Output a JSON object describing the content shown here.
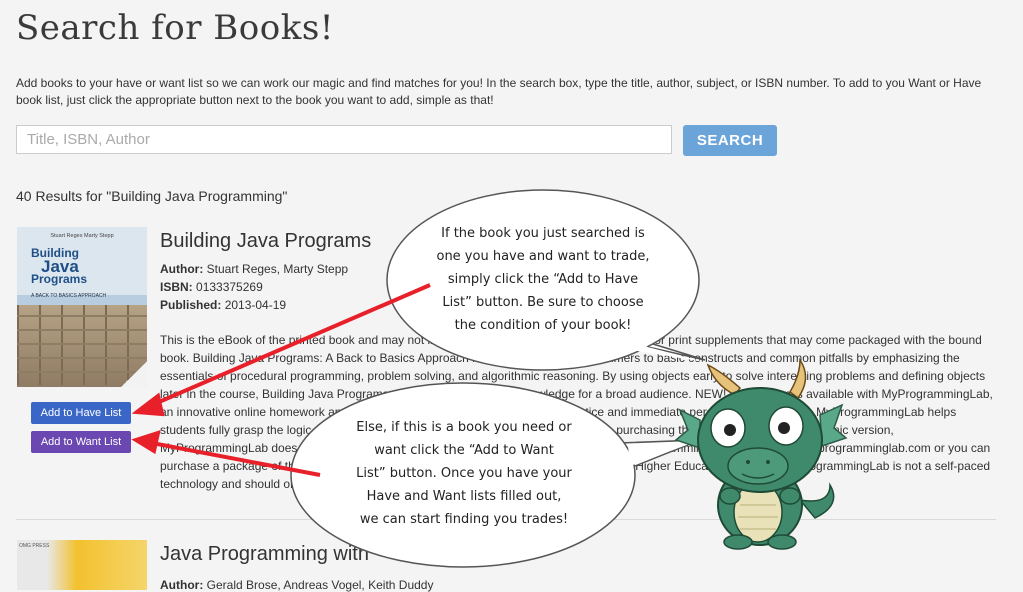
{
  "header": {
    "title": "Search for Books!"
  },
  "intro": "Add books to your have or want list so we can work our magic and find matches for you! In the search box, type the title, author, subject, or ISBN number. To add to you Want or Have book list, just click the appropriate button next to the book you want to add, simple as that!",
  "search": {
    "placeholder": "Title, ISBN, Author",
    "value": "",
    "button_label": "SEARCH"
  },
  "results": {
    "count_label": "40 Results for \"Building Java Programming\"",
    "items": [
      {
        "title": "Building Java Programs",
        "author_label": "Author:",
        "author": "Stuart Reges, Marty Stepp",
        "isbn_label": "ISBN:",
        "isbn": "0133375269",
        "published_label": "Published:",
        "published": "2013-04-19",
        "cover": {
          "authors": "Stuart Reges        Marty Stepp",
          "title_line1": "Building",
          "title_line2": "Java",
          "title_line3": "Programs",
          "subtitle": "A BACK TO BASICS APPROACH"
        },
        "description": "This is the eBook of the printed book and may not include any media, website access codes, or print supplements that may come packaged with the bound book. Building Java Programs: A Back to Basics Approach introduces novice programmers to basic constructs and common pitfalls by emphasizing the essentials of procedural programming, problem solving, and algorithmic reasoning. By using objects early to solve interesting problems and defining objects later in the course, Building Java Programs develops programming knowledge for a broad audience. NEW! This edition is available with MyProgrammingLab, an innovative online homework and assessment tool. Through the power of practice and immediate personalized feedback, MyProgrammingLab helps students fully grasp the logic, semantics, and syntax of programming. Note: If you are purchasing the standalone text or electronic version, MyProgrammingLab does not come automatically packaged with the text. To purchase MyProgrammingLab, please visit: myprogramminglab.com or you can purchase a package of the physical text + MyProgrammingLab by searching the Pearson Higher Education web site. MyProgrammingLab is not a self-paced technology and should only be purchased when required by an instructor.",
        "add_have_label": "Add to Have List",
        "add_want_label": "Add to Want List"
      },
      {
        "title": "Java Programming with",
        "author_label": "Author:",
        "author": "Gerald Brose, Andreas Vogel, Keith Duddy",
        "cover_label": "OMG PRESS"
      }
    ]
  },
  "callouts": {
    "top": [
      "If the book you just searched is",
      "one you have and want to trade,",
      "simply click the “Add to Have",
      "List” button. Be sure to choose",
      "the condition of your book!"
    ],
    "bottom": [
      "Else, if this is a book you need or",
      "want click the “Add to Want",
      "List” button. Once you have your",
      "Have and Want lists filled out,",
      "we can start finding you trades!"
    ]
  },
  "colors": {
    "search_button": "#6aa4d8",
    "have_button": "#3a67c7",
    "want_button": "#6a47b1",
    "arrow": "#e8202a",
    "mascot": "#3f8a6c"
  },
  "icons": {
    "mascot": "green-dragon-mascot-icon"
  }
}
